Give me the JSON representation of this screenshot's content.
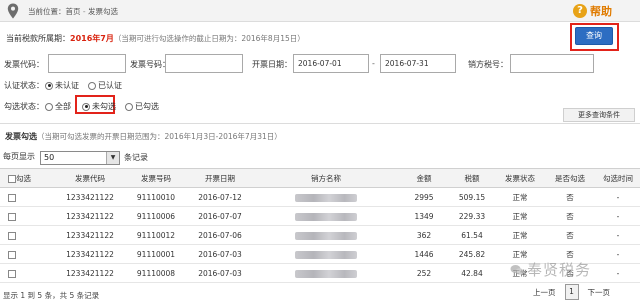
{
  "breadcrumb": {
    "prefix": "当前位置：",
    "home": "首页",
    "separator": " - ",
    "current": "发票勾选"
  },
  "help": {
    "label": "帮助"
  },
  "period": {
    "label": "当前税款所属期：",
    "month": "2016年7月",
    "note": "（当期可进行勾选操作的截止日期为：2016年8月15日）"
  },
  "query_button": "查询",
  "filters": {
    "invoice_code_label": "发票代码：",
    "invoice_number_label": "发票号码：",
    "issue_date_label": "开票日期：",
    "date_from": "2016-07-01",
    "date_to": "2016-07-31",
    "date_separator": "-",
    "seller_tax_id_label": "销方税号：",
    "auth_status_label": "认证状态：",
    "auth_options": [
      "未认证",
      "已认证"
    ],
    "auth_selected": "未认证",
    "select_status_label": "勾选状态：",
    "select_options": [
      "全部",
      "未勾选",
      "已勾选"
    ],
    "select_selected": "未勾选",
    "more_conditions": "更多查询条件"
  },
  "table_header": {
    "title": "发票勾选",
    "range_note": "（当期可勾选发票的开票日期范围为：2016年1月3日-2016年7月31日）"
  },
  "pagination_top": {
    "label": "每页显示",
    "value": "50",
    "suffix": "条记录"
  },
  "columns": [
    "勾选",
    "发票代码",
    "发票号码",
    "开票日期",
    "销方名称",
    "金额",
    "税额",
    "发票状态",
    "是否勾选",
    "勾选时间"
  ],
  "rows": [
    {
      "code": "1233421122",
      "number": "91110010",
      "date": "2016-07-12",
      "amount": "2995",
      "tax": "509.15",
      "status": "正常",
      "checked": "否",
      "time": "-"
    },
    {
      "code": "1233421122",
      "number": "91110006",
      "date": "2016-07-07",
      "amount": "1349",
      "tax": "229.33",
      "status": "正常",
      "checked": "否",
      "time": "-"
    },
    {
      "code": "1233421122",
      "number": "91110012",
      "date": "2016-07-06",
      "amount": "362",
      "tax": "61.54",
      "status": "正常",
      "checked": "否",
      "time": "-"
    },
    {
      "code": "1233421122",
      "number": "91110001",
      "date": "2016-07-03",
      "amount": "1446",
      "tax": "245.82",
      "status": "正常",
      "checked": "否",
      "time": "-"
    },
    {
      "code": "1233421122",
      "number": "91110008",
      "date": "2016-07-03",
      "amount": "252",
      "tax": "42.84",
      "status": "正常",
      "checked": "否",
      "time": "-"
    }
  ],
  "footer": {
    "info": "显示 1 到 5 条，共 5 条记录",
    "prev": "上一页",
    "current_page": "1",
    "next": "下一页"
  },
  "watermark": "奉贤税务",
  "colors": {
    "accent_red": "#d9230f",
    "query_blue": "#2d6dc2",
    "frame_red": "#e2231a",
    "help_orange": "#e07b00"
  }
}
